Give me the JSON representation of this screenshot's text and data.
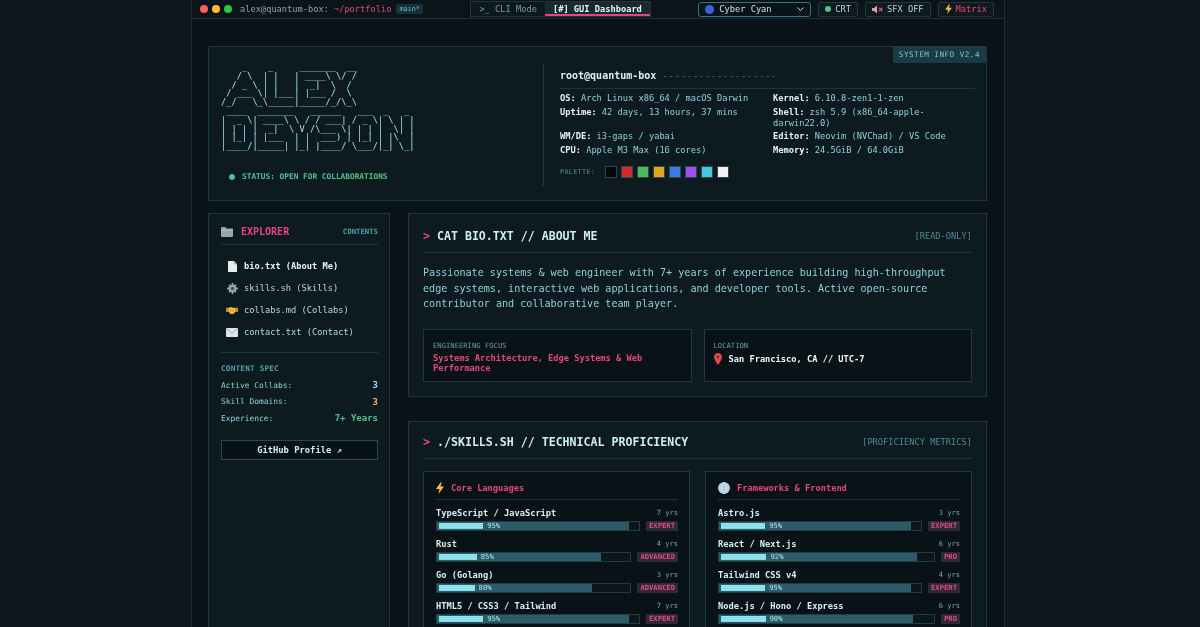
{
  "top_bar": {
    "user_host": "alex@quantum-box:",
    "directory": "~/portfolio",
    "branch": "main*",
    "mode_tabs": [
      {
        "label": ">_ CLI Mode",
        "selected": false
      },
      {
        "label": "[#] GUI Dashboard",
        "selected": true
      }
    ],
    "theme": "Cyber Cyan",
    "crt": {
      "label": "CRT",
      "on": true
    },
    "sfx": {
      "label": "SFX OFF"
    },
    "matrix": {
      "label": "Matrix"
    }
  },
  "system_info": {
    "tag": "SYSTEM INFO V2.4",
    "ascii_art": [
      "    _    _     _______  __",
      "   / \\  | |   | ____\\ \\/ /",
      "  / _ \\ | |   |  _|  \\  / ",
      " / ___ \\| |___| |___ /  \\ ",
      "/_/   \\_\\_____|_____/_/\\_\\",
      " ____  _______   ______   ___  _   _ ",
      "|  _ \\| ____\\ \\ / / ___| / _ \\| \\ | |",
      "| | | |  _|  \\ V /\\___ \\| | | |  \\| |",
      "| |_| | |___  | |  ___) | |_| | |\\  |",
      "|____/|_____| |_| |____/ \\___/|_| \\_|"
    ],
    "status": "STATUS: OPEN FOR COLLABORATIONS",
    "host": "root@quantum-box",
    "host_rule": "-------------------",
    "fields": [
      "**OS:** Arch Linux x86_64 / macOS Darwin",
      "**Kernel:** 6.10.8-zen1-1-zen",
      "**Uptime:** 42 days, 13 hours, 37 mins",
      "**Shell:** zsh 5.9 (x86_64-apple-darwin22.0)",
      "**WM/DE:** i3-gaps / yabai",
      "**Editor:** Neovim (NVChad) / VS Code",
      "**CPU:** Apple M3 Max (16 cores)",
      "**Memory:** 24.5GiB / 64.0GiB"
    ],
    "palette_label": "PALETTE:",
    "palette": [
      {
        "color": "#050505"
      },
      {
        "color": "#d42a2a"
      },
      {
        "color": "#4cbb5a"
      },
      {
        "color": "#e0a820"
      },
      {
        "color": "#3b7be8"
      },
      {
        "color": "#a050f0"
      },
      {
        "color": "#48c4e4"
      },
      {
        "color": "#f2f2f2"
      }
    ]
  },
  "explorer": {
    "title": "EXPLORER",
    "tag": "CONTENTS",
    "files": [
      {
        "label": "bio.txt (About Me)",
        "selected": true
      },
      {
        "label": "skills.sh (Skills)",
        "selected": false
      },
      {
        "label": "collabs.md (Collabs)",
        "selected": false
      },
      {
        "label": "contact.txt (Contact)",
        "selected": false
      }
    ],
    "spec_title": "CONTENT SPEC",
    "spec": [
      {
        "label": "Active Collabs:",
        "value": "3",
        "color": "#8fe0ec"
      },
      {
        "label": "Skill Domains:",
        "value": "3",
        "color": "#f0c33c"
      },
      {
        "label": "Experience:",
        "value": "7+ Years",
        "color": "#4cc38a"
      }
    ],
    "button": "GitHub Profile ↗"
  },
  "bio": {
    "prompt": ">",
    "title": "CAT BIO.TXT // ABOUT ME",
    "tag": "[READ-ONLY]",
    "text": "Passionate systems & web engineer with 7+ years of experience building high-throughput edge systems, interactive web applications, and developer tools. Active open-source contributor and collaborative team player.",
    "cards": [
      {
        "kind": "highlight",
        "label": "ENGINEERING FOCUS",
        "value": "Systems Architecture, Edge Systems & Web Performance"
      },
      {
        "kind": "location",
        "label": "LOCATION",
        "value": "San Francisco, CA // UTC-7"
      }
    ]
  },
  "skills": {
    "prompt": ">",
    "title": "./SKILLS.SH // TECHNICAL PROFICIENCY",
    "tag": "[PROFICIENCY METRICS]",
    "groups": [
      {
        "title": "Core Languages",
        "items": [
          {
            "name": "TypeScript / JavaScript",
            "years": "7 yrs",
            "level": 0.95,
            "percent": "95%",
            "tier": "EXPERT"
          },
          {
            "name": "Rust",
            "years": "4 yrs",
            "level": 0.85,
            "percent": "85%",
            "tier": "ADVANCED"
          },
          {
            "name": "Go (Golang)",
            "years": "3 yrs",
            "level": 0.8,
            "percent": "80%",
            "tier": "ADVANCED"
          },
          {
            "name": "HTML5 / CSS3 / Tailwind",
            "years": "7 yrs",
            "level": 0.95,
            "percent": "95%",
            "tier": "EXPERT"
          }
        ]
      },
      {
        "title": "Frameworks & Frontend",
        "items": [
          {
            "name": "Astro.js",
            "years": "3 yrs",
            "level": 0.95,
            "percent": "95%",
            "tier": "EXPERT"
          },
          {
            "name": "React / Next.js",
            "years": "6 yrs",
            "level": 0.92,
            "percent": "92%",
            "tier": "PRO"
          },
          {
            "name": "Tailwind CSS v4",
            "years": "4 yrs",
            "level": 0.95,
            "percent": "95%",
            "tier": "EXPERT"
          },
          {
            "name": "Node.js / Hono / Express",
            "years": "6 yrs",
            "level": 0.9,
            "percent": "90%",
            "tier": "PRO"
          }
        ]
      }
    ]
  }
}
